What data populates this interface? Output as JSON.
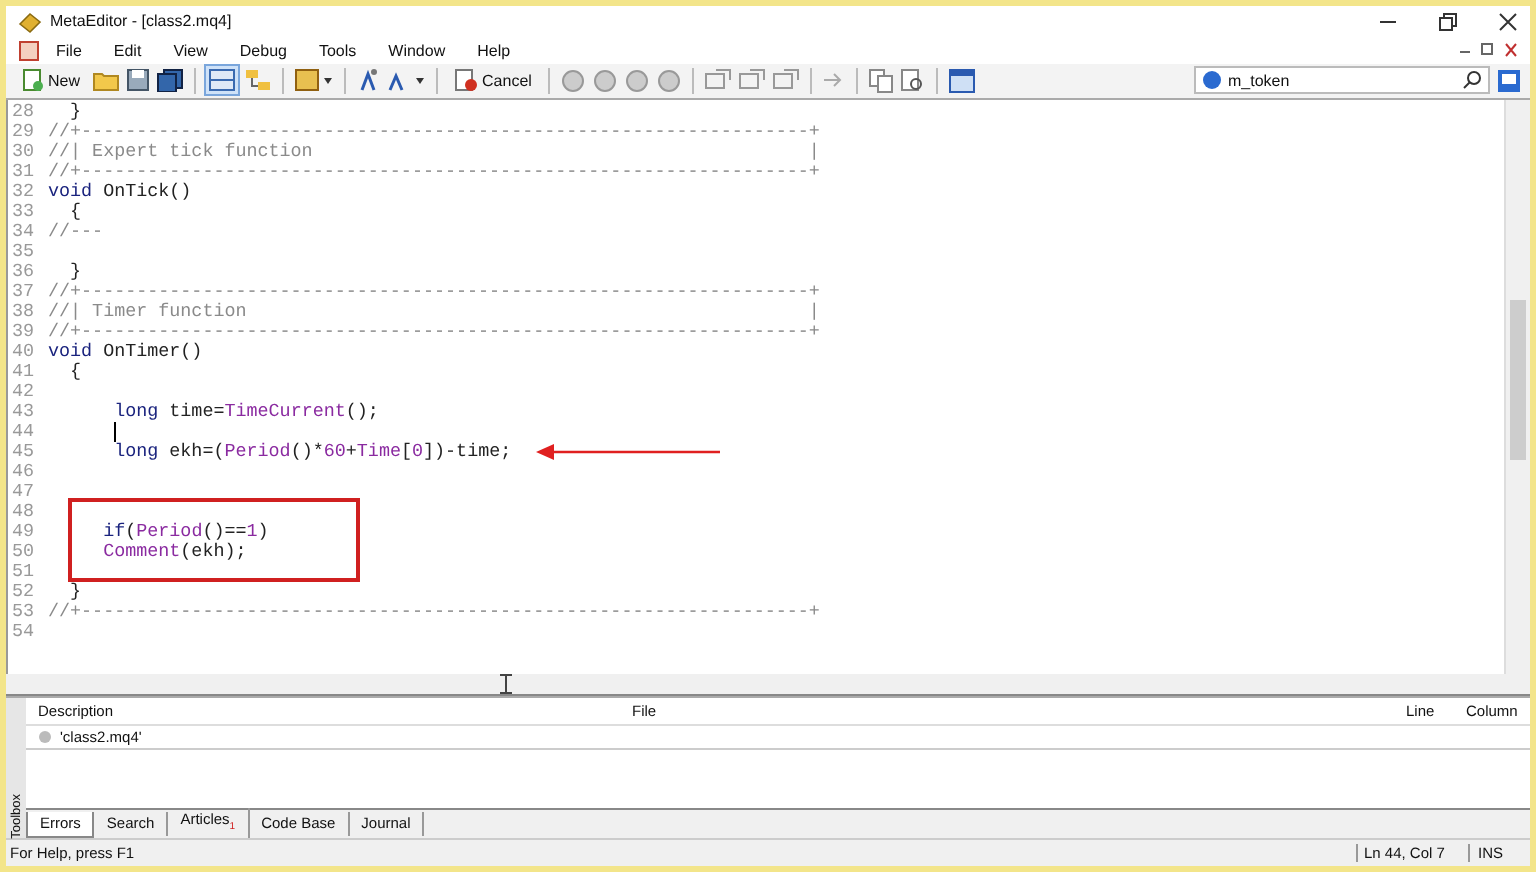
{
  "window": {
    "title": "MetaEditor - [class2.mq4]"
  },
  "menu": [
    "File",
    "Edit",
    "View",
    "Debug",
    "Tools",
    "Window",
    "Help"
  ],
  "toolbar": {
    "new_label": "New",
    "cancel_label": "Cancel"
  },
  "search": {
    "value": "m_token"
  },
  "editor": {
    "lines": [
      {
        "number": "28",
        "tokens": [
          {
            "kind": "txt",
            "text": "  }"
          }
        ]
      },
      {
        "number": "29",
        "tokens": [
          {
            "kind": "cmt",
            "text": "//+------------------------------------------------------------------+"
          }
        ]
      },
      {
        "number": "30",
        "tokens": [
          {
            "kind": "cmt",
            "text": "//| Expert tick function                                             |"
          }
        ]
      },
      {
        "number": "31",
        "tokens": [
          {
            "kind": "cmt",
            "text": "//+------------------------------------------------------------------+"
          }
        ]
      },
      {
        "number": "32",
        "tokens": [
          {
            "kind": "kw",
            "text": "void"
          },
          {
            "kind": "txt",
            "text": " OnTick()"
          }
        ]
      },
      {
        "number": "33",
        "tokens": [
          {
            "kind": "txt",
            "text": "  {"
          }
        ]
      },
      {
        "number": "34",
        "tokens": [
          {
            "kind": "cmt",
            "text": "//---"
          }
        ]
      },
      {
        "number": "35"
      },
      {
        "number": "36",
        "tokens": [
          {
            "kind": "txt",
            "text": "  }"
          }
        ]
      },
      {
        "number": "37",
        "tokens": [
          {
            "kind": "cmt",
            "text": "//+------------------------------------------------------------------+"
          }
        ]
      },
      {
        "number": "38",
        "tokens": [
          {
            "kind": "cmt",
            "text": "//| Timer function                                                   |"
          }
        ]
      },
      {
        "number": "39",
        "tokens": [
          {
            "kind": "cmt",
            "text": "//+------------------------------------------------------------------+"
          }
        ]
      },
      {
        "number": "40",
        "tokens": [
          {
            "kind": "kw",
            "text": "void"
          },
          {
            "kind": "txt",
            "text": " OnTimer()"
          }
        ]
      },
      {
        "number": "41",
        "tokens": [
          {
            "kind": "txt",
            "text": "  {"
          }
        ]
      },
      {
        "number": "42"
      },
      {
        "number": "43",
        "tokens": [
          {
            "kind": "kw",
            "text": "      long"
          },
          {
            "kind": "txt",
            "text": " time="
          },
          {
            "kind": "fn",
            "text": "TimeCurrent"
          },
          {
            "kind": "txt",
            "text": "();"
          }
        ]
      },
      {
        "number": "44",
        "caret": true
      },
      {
        "number": "45",
        "tokens": [
          {
            "kind": "kw",
            "text": "      long"
          },
          {
            "kind": "txt",
            "text": " ekh=("
          },
          {
            "kind": "fn",
            "text": "Period"
          },
          {
            "kind": "txt",
            "text": "()*"
          },
          {
            "kind": "num",
            "text": "60"
          },
          {
            "kind": "txt",
            "text": "+"
          },
          {
            "kind": "fn",
            "text": "Time"
          },
          {
            "kind": "txt",
            "text": "["
          },
          {
            "kind": "num",
            "text": "0"
          },
          {
            "kind": "txt",
            "text": "])-time;"
          }
        ]
      },
      {
        "number": "46"
      },
      {
        "number": "47"
      },
      {
        "number": "48"
      },
      {
        "number": "49",
        "tokens": [
          {
            "kind": "kw",
            "text": "     if"
          },
          {
            "kind": "txt",
            "text": "("
          },
          {
            "kind": "fn",
            "text": "Period"
          },
          {
            "kind": "txt",
            "text": "()=="
          },
          {
            "kind": "num",
            "text": "1"
          },
          {
            "kind": "txt",
            "text": ")"
          }
        ]
      },
      {
        "number": "50",
        "tokens": [
          {
            "kind": "fn",
            "text": "     Comment"
          },
          {
            "kind": "txt",
            "text": "(ekh);"
          }
        ]
      },
      {
        "number": "51"
      },
      {
        "number": "52",
        "tokens": [
          {
            "kind": "txt",
            "text": "  }"
          }
        ]
      },
      {
        "number": "53",
        "tokens": [
          {
            "kind": "cmt",
            "text": "//+------------------------------------------------------------------+"
          }
        ]
      },
      {
        "number": "54"
      }
    ]
  },
  "toolbox": {
    "label": "Toolbox",
    "columns": [
      "Description",
      "File",
      "Line",
      "Column"
    ],
    "rows": [
      {
        "description": "'class2.mq4'"
      }
    ],
    "tabs": [
      {
        "label": "Errors",
        "selected": true
      },
      {
        "label": "Search",
        "selected": false
      },
      {
        "label": "Articles",
        "badge": "1",
        "selected": false
      },
      {
        "label": "Code Base",
        "selected": false
      },
      {
        "label": "Journal",
        "selected": false
      }
    ]
  },
  "status_bar": {
    "help": "For Help, press F1",
    "position": "Ln 44, Col 7",
    "mode": "INS"
  }
}
